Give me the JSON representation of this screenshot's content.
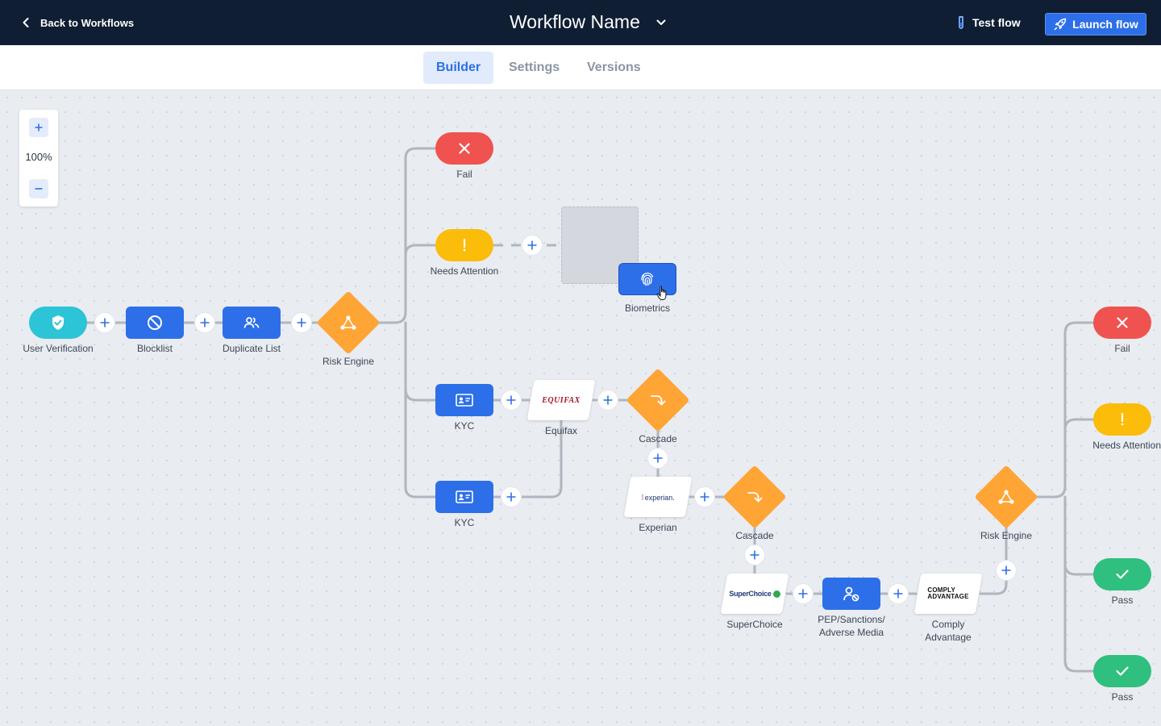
{
  "header": {
    "back_label": "Back to Workflows",
    "workflow_name": "Workflow Name",
    "test_flow_label": "Test flow",
    "launch_flow_label": "Launch flow"
  },
  "tabs": [
    {
      "label": "Builder",
      "active": true
    },
    {
      "label": "Settings",
      "active": false
    },
    {
      "label": "Versions",
      "active": false
    }
  ],
  "zoom": {
    "level": "100%"
  },
  "nodes": {
    "user_verification": "User Verification",
    "blocklist": "Blocklist",
    "duplicate_list": "Duplicate List",
    "risk_engine": "Risk Engine",
    "fail": "Fail",
    "needs_attention": "Needs Attention",
    "biometrics": "Biometrics",
    "kyc": "KYC",
    "equifax": "Equifax",
    "cascade": "Cascade",
    "experian": "Experian",
    "superchoice": "SuperChoice",
    "pep_line1": "PEP/Sanctions/",
    "pep_line2": "Adverse Media",
    "comply_line1": "Comply",
    "comply_line2": "Advantage",
    "pass": "Pass"
  },
  "logos": {
    "equifax": "EQUIFAX",
    "experian": "experian.",
    "superchoice": "SuperChoice",
    "comply_line1": "COMPLY",
    "comply_line2": "ADVANTAGE"
  },
  "colors": {
    "header_bg": "#0f1e33",
    "primary": "#2d6fe8",
    "start": "#2cc4d6",
    "fail": "#f0524f",
    "attention": "#fbbc0a",
    "pass": "#2fbf7e",
    "decision": "#ffa535",
    "connector": "#b0b6bf"
  }
}
